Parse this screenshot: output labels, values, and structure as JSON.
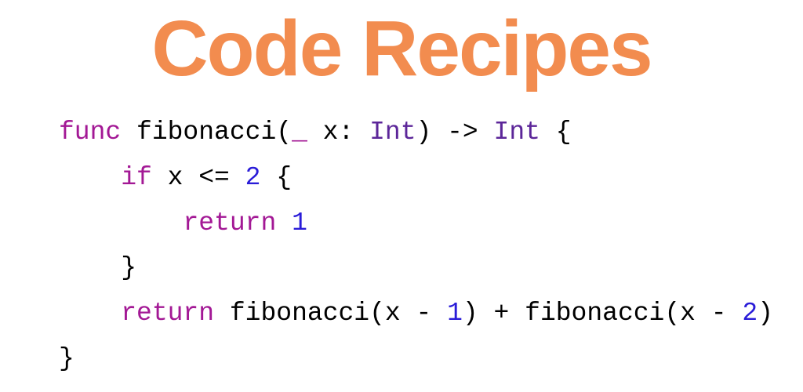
{
  "title": "Code Recipes",
  "code": {
    "line1": {
      "kw_func": "func",
      "name": " fibonacci(",
      "kw_underscore": "_",
      "param": " x: ",
      "type_Int1": "Int",
      "arrow": ") -> ",
      "type_Int2": "Int",
      "brace": " {"
    },
    "line2": {
      "indent": "    ",
      "kw_if": "if",
      "cond": " x <= ",
      "num_2": "2",
      "brace": " {"
    },
    "line3": {
      "indent": "        ",
      "kw_return": "return",
      "space": " ",
      "num_1": "1"
    },
    "line4": {
      "indent": "    ",
      "brace": "}"
    },
    "line5": {
      "indent": "    ",
      "kw_return": "return",
      "part1": " fibonacci(x - ",
      "num_1": "1",
      "part2": ") + fibonacci(x - ",
      "num_2": "2",
      "part3": ")"
    },
    "line6": {
      "brace": "}"
    }
  }
}
